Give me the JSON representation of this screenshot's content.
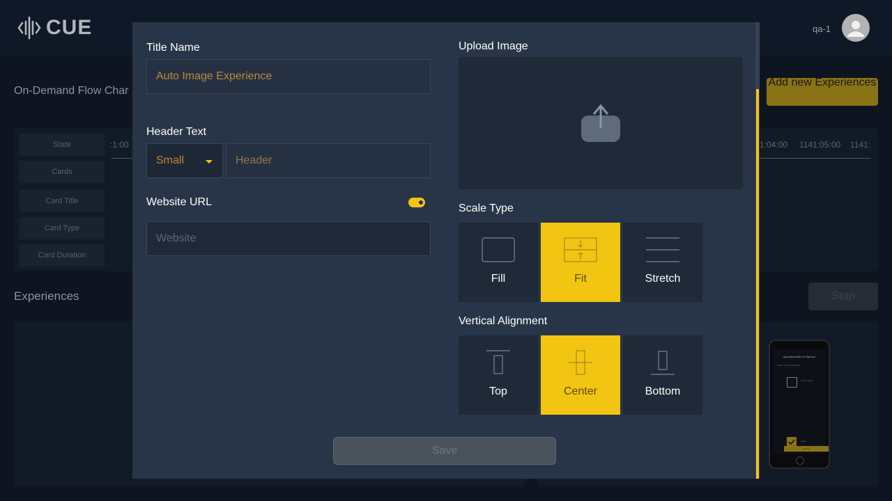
{
  "app": {
    "logo_text": "CUE",
    "user": "qa-1"
  },
  "background": {
    "flow_title": "On-Demand Flow Char",
    "add_button": "Add new Experiences",
    "row_labels": [
      "State",
      "Cards",
      "Card Title",
      "Card Type",
      "Card Duration"
    ],
    "ticks": [
      ":1:00",
      "1:04:00",
      "1141:05:00",
      "1141:("
    ],
    "experiences_title": "Experiences",
    "stop_button": "Stop",
    "phone": {
      "title": "Questionnaire & Opt-ins",
      "subtitle": "Select Content Question *",
      "option_label": "Some choice",
      "checked_label": "Agree",
      "bar_label": "Submit"
    }
  },
  "modal": {
    "title_label": "Title Name",
    "title_value": "Auto Image Experience",
    "header_label": "Header Text",
    "header_size": "Small",
    "header_placeholder": "Header",
    "website_label": "Website URL",
    "website_enabled": true,
    "website_placeholder": "Website",
    "upload_label": "Upload Image",
    "scale_label": "Scale Type",
    "scale_options": [
      {
        "label": "Fill",
        "icon": "fill-icon",
        "selected": false
      },
      {
        "label": "Fit",
        "icon": "fit-icon",
        "selected": true
      },
      {
        "label": "Stretch",
        "icon": "stretch-icon",
        "selected": false
      }
    ],
    "valign_label": "Vertical Alignment",
    "valign_options": [
      {
        "label": "Top",
        "icon": "align-top-icon",
        "selected": false
      },
      {
        "label": "Center",
        "icon": "align-center-icon",
        "selected": true
      },
      {
        "label": "Bottom",
        "icon": "align-bottom-icon",
        "selected": false
      }
    ],
    "save_label": "Save"
  },
  "colors": {
    "accent": "#f2c512",
    "modal_bg": "#283548",
    "input_bg": "#1f2938",
    "page_bg": "#0e1420"
  }
}
